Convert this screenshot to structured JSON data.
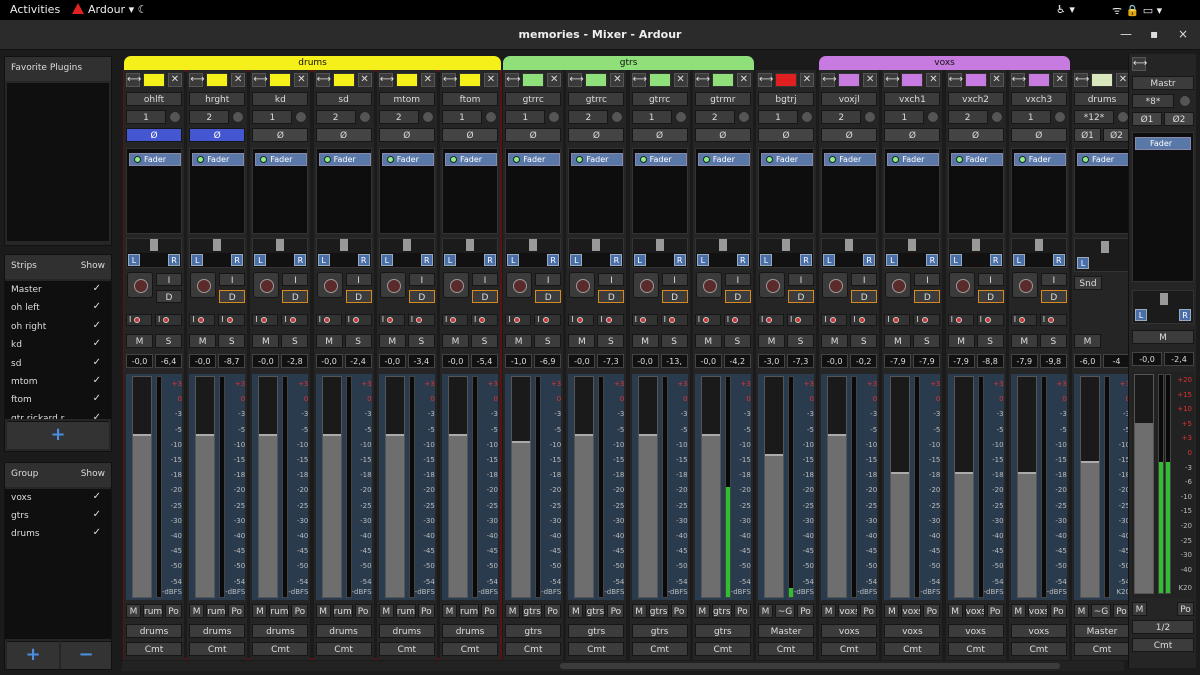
{
  "topbar": {
    "activities": "Activities",
    "app_name": "Ardour",
    "app_arrow": "▾",
    "moon": "☾",
    "access": "♿ ▾",
    "indicators": "ᯤ  🔒  ▭  ▾"
  },
  "window": {
    "title": "memories - Mixer - Ardour",
    "minimize": "—",
    "maximize": "▪",
    "close": "×"
  },
  "left": {
    "favorites": {
      "title": "Favorite Plugins"
    },
    "strips": {
      "title": "Strips",
      "show": "Show",
      "items": [
        {
          "name": "Master",
          "shown": "✓"
        },
        {
          "name": "oh left",
          "shown": "✓"
        },
        {
          "name": "oh right",
          "shown": "✓"
        },
        {
          "name": "kd",
          "shown": "✓"
        },
        {
          "name": "sd",
          "shown": "✓"
        },
        {
          "name": "mtom",
          "shown": "✓"
        },
        {
          "name": "ftom",
          "shown": "✓"
        },
        {
          "name": "gtr rickard r",
          "shown": "✓"
        }
      ],
      "add": "+"
    },
    "groups": {
      "title": "Group",
      "show": "Show",
      "items": [
        {
          "name": "voxs",
          "shown": "✓"
        },
        {
          "name": "gtrs",
          "shown": "✓"
        },
        {
          "name": "drums",
          "shown": "✓"
        }
      ],
      "add": "+",
      "remove": "−"
    }
  },
  "groups_bar": [
    {
      "name": "drums",
      "color": "#f5ef1a",
      "strips": 6
    },
    {
      "name": "gtrs",
      "color": "#8fe07a",
      "strips": 4
    },
    {
      "name": "",
      "color": "none",
      "strips": 1
    },
    {
      "name": "voxs",
      "color": "#c77ae0",
      "strips": 4
    }
  ],
  "common": {
    "fader_plugin": "Fader",
    "phase": "Ø",
    "input": "I",
    "disk": "D",
    "mute": "M",
    "solo": "S",
    "post": "Po",
    "comments": "Cmt",
    "width": "⟷",
    "close": "✕",
    "pan_left": "L",
    "pan_right": "R",
    "rec_i": "I",
    "dbfs": "-dBFS"
  },
  "scale": [
    {
      "v": "+3",
      "red": true
    },
    {
      "v": "0",
      "red": true
    },
    {
      "v": "-3",
      "red": false
    },
    {
      "v": "-5",
      "red": false
    },
    {
      "v": "-10",
      "red": false
    },
    {
      "v": "-15",
      "red": false
    },
    {
      "v": "-18",
      "red": false
    },
    {
      "v": "-20",
      "red": false
    },
    {
      "v": "-25",
      "red": false
    },
    {
      "v": "-30",
      "red": false
    },
    {
      "v": "-40",
      "red": false
    },
    {
      "v": "-45",
      "red": false
    },
    {
      "v": "-50",
      "red": false
    },
    {
      "v": "-54",
      "red": false
    }
  ],
  "strips": [
    {
      "name": "ohlft",
      "color": "#f5ef1a",
      "input": "1",
      "phase_on": true,
      "gain": "-0,0",
      "peak": "-6,4",
      "fader": 0.74,
      "meter": 0,
      "group": "drums",
      "bus": "rum",
      "disk_on": false
    },
    {
      "name": "hrght",
      "color": "#f5ef1a",
      "input": "2",
      "phase_on": true,
      "gain": "-0,0",
      "peak": "-8,7",
      "fader": 0.74,
      "meter": 0,
      "group": "drums",
      "bus": "rum",
      "disk_on": true
    },
    {
      "name": "kd",
      "color": "#f5ef1a",
      "input": "1",
      "phase_on": false,
      "gain": "-0,0",
      "peak": "-2,8",
      "fader": 0.74,
      "meter": 0,
      "group": "drums",
      "bus": "rum",
      "disk_on": true
    },
    {
      "name": "sd",
      "color": "#f5ef1a",
      "input": "2",
      "phase_on": false,
      "gain": "-0,0",
      "peak": "-2,4",
      "fader": 0.74,
      "meter": 0,
      "group": "drums",
      "bus": "rum",
      "disk_on": true
    },
    {
      "name": "mtom",
      "color": "#f5ef1a",
      "input": "2",
      "phase_on": false,
      "gain": "-0,0",
      "peak": "-3,4",
      "fader": 0.74,
      "meter": 0,
      "group": "drums",
      "bus": "rum",
      "disk_on": true
    },
    {
      "name": "ftom",
      "color": "#f5ef1a",
      "input": "1",
      "phase_on": false,
      "gain": "-0,0",
      "peak": "-5,4",
      "fader": 0.74,
      "meter": 0,
      "group": "drums",
      "bus": "rum",
      "disk_on": true
    },
    {
      "name": "gtrrc",
      "color": "#8fe07a",
      "input": "1",
      "phase_on": false,
      "gain": "-1,0",
      "peak": "-6,9",
      "fader": 0.71,
      "meter": 0,
      "group": "gtrs",
      "bus": "gtrs",
      "disk_on": true
    },
    {
      "name": "gtrrc",
      "color": "#8fe07a",
      "input": "2",
      "phase_on": false,
      "gain": "-0,0",
      "peak": "-7,3",
      "fader": 0.74,
      "meter": 0,
      "group": "gtrs",
      "bus": "gtrs",
      "disk_on": true
    },
    {
      "name": "gtrrc",
      "color": "#8fe07a",
      "input": "1",
      "phase_on": false,
      "gain": "-0,0",
      "peak": "-13,",
      "fader": 0.74,
      "meter": 0,
      "group": "gtrs",
      "bus": "gtrs",
      "disk_on": true
    },
    {
      "name": "gtrmr",
      "color": "#8fe07a",
      "input": "2",
      "phase_on": false,
      "gain": "-0,0",
      "peak": "-4,2",
      "fader": 0.74,
      "meter": 0.5,
      "group": "gtrs",
      "bus": "gtrs",
      "disk_on": true
    },
    {
      "name": "bgtrj",
      "color": "#e02020",
      "input": "1",
      "phase_on": false,
      "gain": "-3,0",
      "peak": "-7,3",
      "fader": 0.65,
      "meter": 0.04,
      "group": "Master",
      "bus": "~G",
      "disk_on": true
    },
    {
      "name": "voxjl",
      "color": "#c77ae0",
      "input": "2",
      "phase_on": false,
      "gain": "-0,0",
      "peak": "-0,2",
      "fader": 0.74,
      "meter": 0,
      "group": "voxs",
      "bus": "voxs",
      "disk_on": true
    },
    {
      "name": "vxch1",
      "color": "#c77ae0",
      "input": "1",
      "phase_on": false,
      "gain": "-7,9",
      "peak": "-7,9",
      "fader": 0.57,
      "meter": 0,
      "group": "voxs",
      "bus": "voxs",
      "disk_on": true
    },
    {
      "name": "vxch2",
      "color": "#c77ae0",
      "input": "2",
      "phase_on": false,
      "gain": "-7,9",
      "peak": "-8,8",
      "fader": 0.57,
      "meter": 0,
      "group": "voxs",
      "bus": "voxs",
      "disk_on": true
    },
    {
      "name": "vxch3",
      "color": "#c77ae0",
      "input": "1",
      "phase_on": false,
      "gain": "-7,9",
      "peak": "-9,8",
      "fader": 0.57,
      "meter": 0,
      "group": "voxs",
      "bus": "voxs",
      "disk_on": true
    }
  ],
  "bus": {
    "name": "drums",
    "color": "#d9e8bc",
    "input": "*12*",
    "phase1": "Ø1",
    "phase2": "Ø2",
    "send": "Snd",
    "mute": "M",
    "gain": "-6,0",
    "peak": "-4",
    "fader": 0.62,
    "group": "Master",
    "bus_btn": "~G",
    "k": "K20"
  },
  "master": {
    "name": "Mastr",
    "input": "*8*",
    "phase1": "Ø1",
    "phase2": "Ø2",
    "fader_plugin": "Fader",
    "mute": "M",
    "gain": "-0,0",
    "peak": "-2,4",
    "fader": 0.78,
    "meter": 0.6,
    "pan_left": "L",
    "pan_right": "R",
    "k": "K20",
    "post": "Po",
    "output": "1/2",
    "comments": "Cmt",
    "scale": [
      "+20",
      "+15",
      "+10",
      "+5",
      "+3",
      "0",
      "-3",
      "-6",
      "-10",
      "-15",
      "-20",
      "-25",
      "-30",
      "-40"
    ]
  }
}
